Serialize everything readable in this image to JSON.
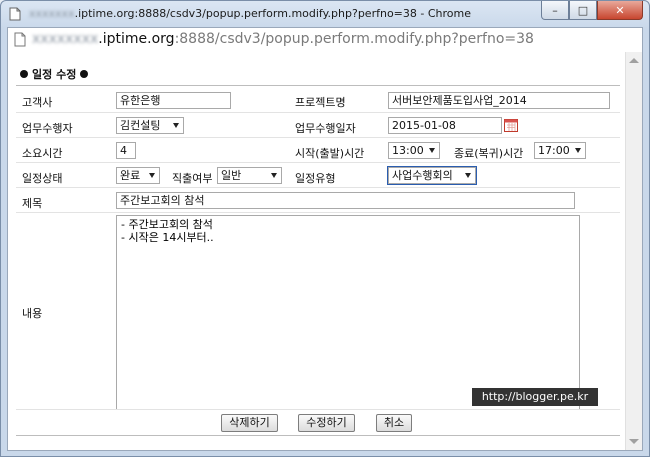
{
  "window": {
    "title_blurred": "xxxxxxx",
    "title": ".iptime.org:8888/csdv3/popup.perform.modify.php?perfno=38 - Chrome",
    "minimize_glyph": "–",
    "maximize_glyph": "□",
    "close_glyph": "✕"
  },
  "address_bar": {
    "blurred": "xxxxxxxx",
    "host": ".iptime.org",
    "path": ":8888/csdv3/popup.perform.modify.php?perfno=38"
  },
  "form": {
    "heading": "일정 수정",
    "customer": {
      "label": "고객사",
      "value": "유한은행"
    },
    "project": {
      "label": "프로젝트명",
      "value": "서버보안제품도입사업_2014"
    },
    "performer": {
      "label": "업무수행자",
      "value": "김컨설팅"
    },
    "perform_date": {
      "label": "업무수행일자",
      "value": "2015-01-08"
    },
    "duration": {
      "label": "소요시간",
      "value": "4"
    },
    "start_time": {
      "label": "시작(출발)시간",
      "value": "13:00"
    },
    "end_time": {
      "label": "종료(복귀)시간",
      "value": "17:00"
    },
    "status": {
      "label": "일정상태",
      "value": "완료"
    },
    "direct_return": {
      "label": "직출여부",
      "value": "일반"
    },
    "schedule_type": {
      "label": "일정유형",
      "value": "사업수행회의"
    },
    "subject": {
      "label": "제목",
      "value": "주간보고회의 참석"
    },
    "body": {
      "label": "내용",
      "value": "- 주간보고회의 참석\n- 시작은 14시부터.."
    }
  },
  "buttons": {
    "delete": "삭제하기",
    "modify": "수정하기",
    "cancel": "취소"
  },
  "watermark": "http://blogger.pe.kr"
}
